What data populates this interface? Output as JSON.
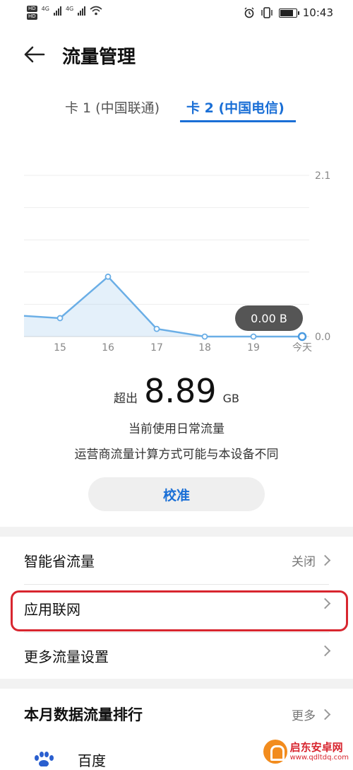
{
  "status_bar": {
    "hd_badges": [
      "HD",
      "HD"
    ],
    "time": "10:43",
    "network_labels": [
      "4G",
      "4G"
    ]
  },
  "header": {
    "title": "流量管理"
  },
  "tabs": [
    {
      "label": "卡 1 (中国联通)",
      "active": false
    },
    {
      "label": "卡 2 (中国电信)",
      "active": true
    }
  ],
  "chart_data": {
    "type": "line",
    "x": [
      "14",
      "15",
      "16",
      "17",
      "18",
      "19",
      "今天"
    ],
    "x_tick_labels": [
      "15",
      "16",
      "17",
      "18",
      "19",
      "今天"
    ],
    "series": [
      {
        "values": [
          0.27,
          0.24,
          0.78,
          0.1,
          0.0,
          0.0,
          0.0
        ]
      }
    ],
    "y_tick_labels": [
      "2.1",
      "0.0"
    ],
    "ylim": [
      0,
      2.1
    ],
    "grid": true,
    "highlight_label": "0.00 B",
    "color": "#6aaee6"
  },
  "summary": {
    "exceed_label": "超出",
    "exceed_value": "8.89",
    "exceed_unit": "GB",
    "line1": "当前使用日常流量",
    "line2": "运营商流量计算方式可能与本设备不同",
    "calibrate_button": "校准"
  },
  "settings": [
    {
      "label": "智能省流量",
      "value": "关闭"
    },
    {
      "label": "应用联网",
      "value": ""
    },
    {
      "label": "更多流量设置",
      "value": ""
    }
  ],
  "ranking": {
    "title": "本月数据流量排行",
    "more_label": "更多",
    "apps": [
      {
        "name": "百度"
      }
    ]
  },
  "watermark": {
    "name": "启东安卓网",
    "url": "www.qdltdq.com"
  },
  "colors": {
    "accent": "#1a6fd6",
    "highlight_border": "#d8262f"
  }
}
